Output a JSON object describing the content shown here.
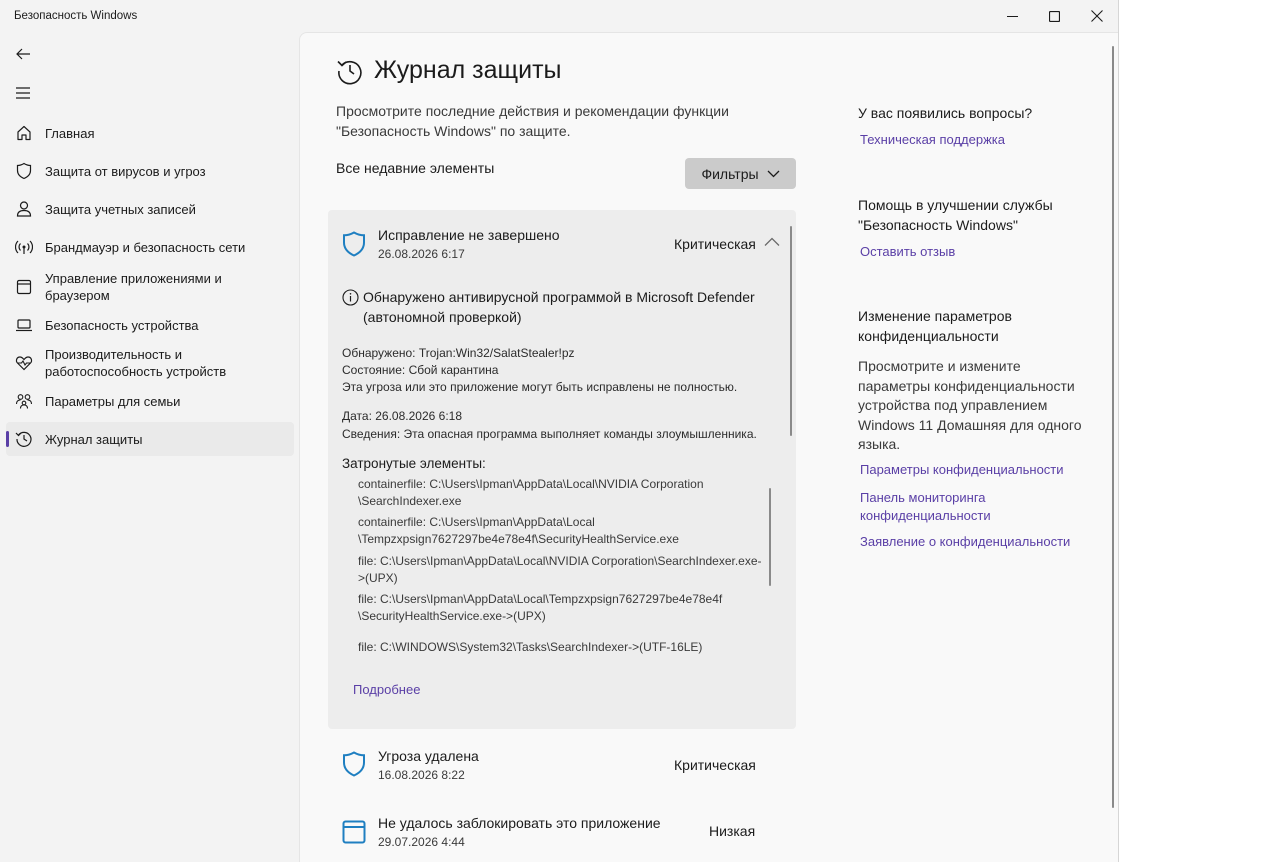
{
  "window": {
    "title": "Безопасность Windows",
    "accent": "#5a3fa6"
  },
  "nav": {
    "items": [
      {
        "label": "Главная",
        "icon": "home-icon"
      },
      {
        "label": "Защита от вирусов и угроз",
        "icon": "shield-icon"
      },
      {
        "label": "Защита учетных записей",
        "icon": "person-icon"
      },
      {
        "label": "Брандмауэр и безопасность сети",
        "icon": "wifi-icon"
      },
      {
        "label": "Управление приложениями и браузером",
        "icon": "app-browser-icon"
      },
      {
        "label": "Безопасность устройства",
        "icon": "laptop-icon"
      },
      {
        "label": "Производительность и работоспособность устройств",
        "icon": "heart-icon"
      },
      {
        "label": "Параметры для семьи",
        "icon": "family-icon"
      },
      {
        "label": "Журнал защиты",
        "icon": "history-icon"
      }
    ]
  },
  "page": {
    "title": "Журнал защиты",
    "description": "Просмотрите последние действия и рекомендации функции \"Безопасность Windows\" по защите.",
    "recent_label": "Все недавние элементы",
    "filters_label": "Фильтры"
  },
  "expanded_item": {
    "title": "Исправление не завершено",
    "date": "26.08.2026 6:17",
    "severity": "Критическая",
    "detected_by": "Обнаружено антивирусной программой в Microsoft Defender (автономной проверкой)",
    "detected_label": "Обнаружено:",
    "detected_value": "Trojan:Win32/SalatStealer!pz",
    "status_label": "Состояние:",
    "status_value": "Сбой карантина",
    "warning": "Эта угроза или это приложение могут быть исправлены не полностью.",
    "date_label": "Дата:",
    "date_value": "26.08.2026 6:18",
    "details_label": "Сведения:",
    "details_value": "Эта опасная программа выполняет команды злоумышленника.",
    "affected_label": "Затронутые элементы:",
    "affected": [
      "containerfile: C:\\Users\\Ipman\\AppData\\Local\\NVIDIA Corporation \\SearchIndexer.exe",
      "containerfile: C:\\Users\\Ipman\\AppData\\Local \\Tempzxpsign7627297be4e78e4f\\SecurityHealthService.exe",
      "file: C:\\Users\\Ipman\\AppData\\Local\\NVIDIA Corporation\\SearchIndexer.exe->(UPX)",
      "file: C:\\Users\\Ipman\\AppData\\Local\\Tempzxpsign7627297be4e78e4f \\SecurityHealthService.exe->(UPX)",
      "file: C:\\WINDOWS\\System32\\Tasks\\SearchIndexer->(UTF-16LE)"
    ],
    "more_link": "Подробнее"
  },
  "items": [
    {
      "title": "Угроза удалена",
      "date": "16.08.2026 8:22",
      "severity": "Критическая"
    },
    {
      "title": "Не удалось заблокировать это приложение",
      "date": "29.07.2026 4:44",
      "severity": "Низкая"
    }
  ],
  "right": {
    "questions_title": "У вас появились вопросы?",
    "support_link": "Техническая поддержка",
    "improve_title": "Помощь в улучшении службы \"Безопасность Windows\"",
    "feedback_link": "Оставить отзыв",
    "privacy_title": "Изменение параметров конфиденциальности",
    "privacy_text": "Просмотрите и измените параметры конфиденциальности устройства под управлением Windows 11 Домашняя для одного языка.",
    "privacy_links": [
      "Параметры конфиденциальности",
      "Панель мониторинга конфиденциальности",
      "Заявление о конфиденциальности"
    ]
  }
}
